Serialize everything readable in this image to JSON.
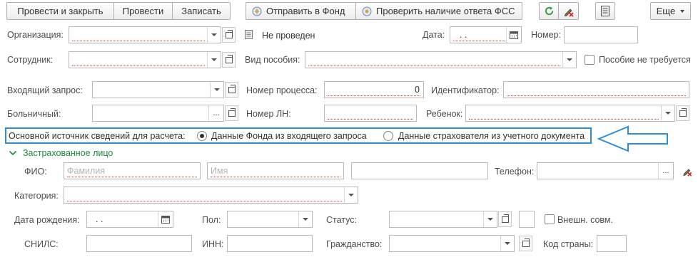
{
  "toolbar": {
    "post_close": "Провести и закрыть",
    "post": "Провести",
    "save": "Записать",
    "send_fund": "Отправить в Фонд",
    "check_fss": "Проверить наличие ответа ФСС",
    "more": "Еще"
  },
  "header": {
    "organization_label": "Организация:",
    "status_text": "Не проведен",
    "date_label": "Дата:",
    "date_value": ". .",
    "number_label": "Номер:",
    "employee_label": "Сотрудник:",
    "benefit_type_label": "Вид пособия:",
    "benefit_not_required_label": "Пособие не требуется"
  },
  "request": {
    "incoming_label": "Входящий запрос:",
    "process_number_label": "Номер процесса:",
    "process_number_value": "0",
    "identifier_label": "Идентификатор:",
    "sick_leave_label": "Больничный:",
    "ln_number_label": "Номер ЛН:",
    "child_label": "Ребенок:"
  },
  "source": {
    "label": "Основной источник сведений для расчета:",
    "option_fund": "Данные Фонда из входящего запроса",
    "option_insurer": "Данные страхователя из учетного документа",
    "selected": "option_fund"
  },
  "insured": {
    "section_title": "Застрахованное лицо",
    "fio_label": "ФИО:",
    "lastname_placeholder": "Фамилия",
    "firstname_placeholder": "Имя",
    "phone_label": "Телефон:",
    "category_label": "Категория:",
    "birth_label": "Дата рождения:",
    "birth_value": ". .",
    "sex_label": "Пол:",
    "status_label": "Статус:",
    "external_label": "Внешн. совм.",
    "snils_label": "СНИЛС:",
    "inn_label": "ИНН:",
    "citizenship_label": "Гражданство:",
    "country_code_label": "Код страны:"
  },
  "colors": {
    "accent_green": "#1e8a3c",
    "highlight_blue": "#2a8fd6",
    "required_red": "#e04040"
  }
}
